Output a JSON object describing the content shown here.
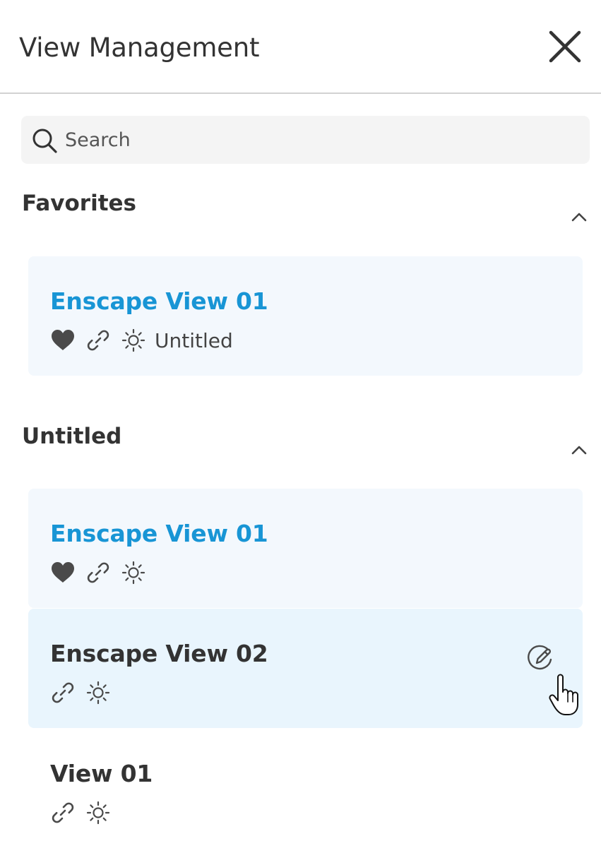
{
  "header": {
    "title": "View Management",
    "close_icon": "close-icon"
  },
  "search": {
    "placeholder": "Search",
    "value": "",
    "icon": "search-icon"
  },
  "sections": [
    {
      "title": "Favorites",
      "collapsed": false,
      "items": [
        {
          "title": "Enscape View 01",
          "favorite": true,
          "linked": true,
          "sun": true,
          "tag": "Untitled",
          "state": "favorite"
        }
      ]
    },
    {
      "title": "Untitled",
      "collapsed": false,
      "items": [
        {
          "title": "Enscape View 01",
          "favorite": true,
          "linked": true,
          "sun": true,
          "state": "favorite"
        },
        {
          "title": "Enscape View 02",
          "favorite": false,
          "linked": true,
          "sun": true,
          "state": "hovered",
          "action_icon": "edit-icon"
        },
        {
          "title": "View 01",
          "favorite": false,
          "linked": true,
          "sun": true,
          "state": "normal"
        }
      ]
    }
  ],
  "colors": {
    "accent": "#1895d5",
    "text": "#333333",
    "favorite_card_bg": "#f3f8fd",
    "hover_card_bg": "#e9f5fd",
    "search_bg": "#f4f4f4",
    "icon": "#4a4a4a"
  }
}
